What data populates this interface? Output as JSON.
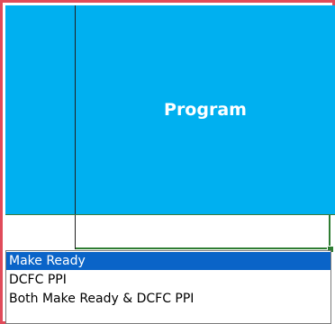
{
  "header": {
    "program_label": "Program"
  },
  "dropdown": {
    "options": [
      "Make Ready",
      "DCFC PPI",
      "Both Make Ready & DCFC PPI"
    ],
    "selected_index": 0
  },
  "colors": {
    "header_fill": "#00b0f0",
    "selection": "#0a64c8",
    "active_cell_border": "#2e7d32",
    "frame": "#e04b5a"
  }
}
